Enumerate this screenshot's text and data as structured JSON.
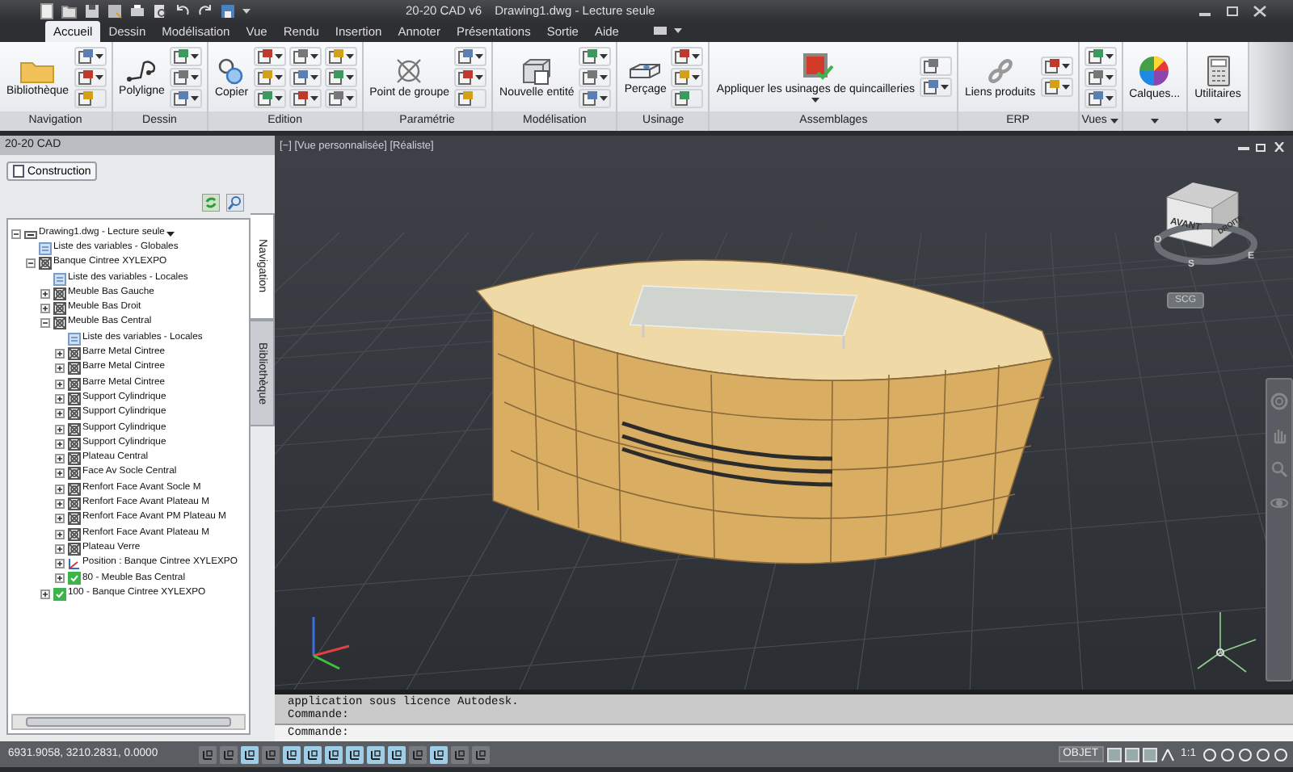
{
  "title_bar": {
    "app": "20-20 CAD v6",
    "document": "Drawing1.dwg - Lecture seule"
  },
  "ribbon_tabs": [
    {
      "label": "Accueil",
      "selected": true
    },
    {
      "label": "Dessin",
      "selected": false
    },
    {
      "label": "Modélisation",
      "selected": false
    },
    {
      "label": "Vue",
      "selected": false
    },
    {
      "label": "Rendu",
      "selected": false
    },
    {
      "label": "Insertion",
      "selected": false
    },
    {
      "label": "Annoter",
      "selected": false
    },
    {
      "label": "Présentations",
      "selected": false
    },
    {
      "label": "Sortie",
      "selected": false
    },
    {
      "label": "Aide",
      "selected": false
    }
  ],
  "ribbon_panels": [
    {
      "title": "Navigation",
      "button": "Bibliothèque",
      "small_buttons": [
        {
          "menu": true
        },
        {
          "menu": true
        },
        {
          "menu": false
        }
      ]
    },
    {
      "title": "Dessin",
      "button": "Polyligne",
      "small_buttons": [
        {
          "menu": true
        },
        {
          "menu": true
        },
        {
          "menu": true
        }
      ]
    },
    {
      "title": "Edition",
      "button": "Copier",
      "small_buttons": [
        {
          "menu": true
        },
        {
          "menu": true
        },
        {
          "menu": true
        },
        {
          "menu": true
        },
        {
          "menu": true
        },
        {
          "menu": true
        },
        {
          "menu": true
        },
        {
          "menu": true
        },
        {
          "menu": true
        }
      ]
    },
    {
      "title": "Paramétrie",
      "button": "Point de groupe",
      "small_buttons": [
        {
          "menu": true
        },
        {
          "menu": true
        },
        {
          "menu": false
        }
      ]
    },
    {
      "title": "Modélisation",
      "button": "Nouvelle entité",
      "small_buttons": [
        {
          "menu": true
        },
        {
          "menu": true
        },
        {
          "menu": true
        }
      ]
    },
    {
      "title": "Usinage",
      "button": "Perçage",
      "small_buttons": [
        {
          "menu": true
        },
        {
          "menu": true
        },
        {
          "menu": false
        }
      ]
    },
    {
      "title": "Assemblages",
      "button": "Appliquer les usinages de quincailleries",
      "button_menu": true,
      "small_buttons": [
        {
          "menu": false
        },
        {
          "menu": true
        }
      ]
    },
    {
      "title": "ERP",
      "button": "Liens produits",
      "small_buttons": [
        {
          "menu": true
        },
        {
          "menu": true
        }
      ]
    },
    {
      "title": "Vues",
      "menu": true,
      "small_buttons": [
        {
          "menu": true
        },
        {
          "menu": true
        },
        {
          "menu": true
        }
      ]
    },
    {
      "button": "Calques...",
      "menu": true
    },
    {
      "button": "Utilitaires",
      "menu": true
    }
  ],
  "palette": {
    "title": "20-20 CAD",
    "mode_button": "Construction",
    "side_tabs": [
      {
        "label": "Navigation",
        "selected": true
      },
      {
        "label": "Bibliothèque",
        "selected": false
      }
    ],
    "tree": [
      {
        "label": "Drawing1.dwg - Lecture seule",
        "kind": "drawing",
        "expanded": true,
        "children": [
          {
            "label": "Liste des variables - Globales",
            "kind": "list"
          },
          {
            "label": "Banque Cintree XYLEXPO",
            "kind": "part",
            "expanded": true,
            "children": [
              {
                "label": "Liste des variables - Locales",
                "kind": "list"
              },
              {
                "label": "Meuble Bas Gauche",
                "kind": "part",
                "expanded": false
              },
              {
                "label": "Meuble Bas Droit",
                "kind": "part",
                "expanded": false
              },
              {
                "label": "Meuble Bas Central",
                "kind": "part",
                "expanded": true,
                "children": [
                  {
                    "label": "Liste des variables - Locales",
                    "kind": "list"
                  },
                  {
                    "label": "Barre Metal Cintree",
                    "kind": "part",
                    "expanded": false
                  },
                  {
                    "label": "Barre Metal Cintree",
                    "kind": "part",
                    "expanded": false
                  },
                  {
                    "label": "Barre Metal Cintree",
                    "kind": "part",
                    "expanded": false
                  },
                  {
                    "label": "Support Cylindrique",
                    "kind": "part",
                    "expanded": false
                  },
                  {
                    "label": "Support Cylindrique",
                    "kind": "part",
                    "expanded": false
                  },
                  {
                    "label": "Support Cylindrique",
                    "kind": "part",
                    "expanded": false
                  },
                  {
                    "label": "Support Cylindrique",
                    "kind": "part",
                    "expanded": false
                  },
                  {
                    "label": "Plateau Central",
                    "kind": "part",
                    "expanded": false
                  },
                  {
                    "label": "Face Av Socle Central",
                    "kind": "part",
                    "expanded": false
                  },
                  {
                    "label": "Renfort Face Avant Socle M",
                    "kind": "part",
                    "expanded": false
                  },
                  {
                    "label": "Renfort Face Avant Plateau M",
                    "kind": "part",
                    "expanded": false
                  },
                  {
                    "label": "Renfort Face Avant PM Plateau M",
                    "kind": "part",
                    "expanded": false
                  },
                  {
                    "label": "Renfort Face Avant Plateau M",
                    "kind": "part",
                    "expanded": false
                  },
                  {
                    "label": "Plateau Verre",
                    "kind": "part",
                    "expanded": false
                  },
                  {
                    "label": "Position : Banque Cintree XYLEXPO",
                    "kind": "position",
                    "expanded": false
                  },
                  {
                    "label": "80 - Meuble Bas Central",
                    "kind": "check",
                    "expanded": false
                  }
                ]
              },
              {
                "label": "100 - Banque Cintree XYLEXPO",
                "kind": "check",
                "expanded": false
              }
            ]
          }
        ]
      }
    ]
  },
  "viewport": {
    "label": "[−] [Vue personnalisée] [Réaliste]",
    "cube_faces": [
      "AVANT",
      "DROITE"
    ],
    "compass": [
      "O",
      "S",
      "E"
    ],
    "ucs_button": "SCG"
  },
  "command": {
    "history": [
      "application sous licence Autodesk.",
      "Commande:"
    ],
    "prompt": "Commande:"
  },
  "status_bar": {
    "coordinates": "6931.9058, 3210.2831, 0.0000",
    "toggles": [
      {
        "on": false
      },
      {
        "on": false
      },
      {
        "on": true
      },
      {
        "on": false
      },
      {
        "on": true
      },
      {
        "on": true
      },
      {
        "on": true
      },
      {
        "on": true
      },
      {
        "on": true
      },
      {
        "on": true
      },
      {
        "on": false
      },
      {
        "on": true
      },
      {
        "on": false
      },
      {
        "on": false
      }
    ],
    "space": "OBJET",
    "scale": "1:1"
  }
}
